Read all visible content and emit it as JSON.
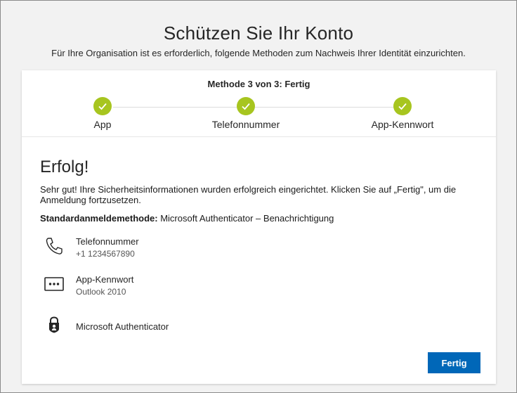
{
  "page": {
    "title": "Schützen Sie Ihr Konto",
    "subtitle": "Für Ihre Organisation ist es erforderlich, folgende Methoden zum Nachweis Ihrer Identität einzurichten."
  },
  "progress": {
    "label": "Methode 3 von 3: Fertig",
    "steps": [
      {
        "label": "App",
        "icon": "check-icon",
        "status": "complete"
      },
      {
        "label": "Telefonnummer",
        "icon": "check-icon",
        "status": "complete"
      },
      {
        "label": "App-Kennwort",
        "icon": "check-icon",
        "status": "complete"
      }
    ],
    "color": "#a7c51f"
  },
  "result": {
    "heading": "Erfolg!",
    "message": "Sehr gut! Ihre Sicherheitsinformationen wurden erfolgreich eingerichtet. Klicken Sie auf „Fertig\", um die Anmeldung fortzusetzen.",
    "default_label": "Standardanmeldemethode:",
    "default_value": "Microsoft Authenticator – Benachrichtigung"
  },
  "methods": [
    {
      "icon": "phone-icon",
      "name": "Telefonnummer",
      "detail": "+1 1234567890"
    },
    {
      "icon": "password-icon",
      "name": "App-Kennwort",
      "detail": "Outlook 2010"
    },
    {
      "icon": "authenticator-lock-icon",
      "name": "Microsoft Authenticator",
      "detail": ""
    }
  ],
  "actions": {
    "done_label": "Fertig",
    "accent": "#0067b8"
  }
}
